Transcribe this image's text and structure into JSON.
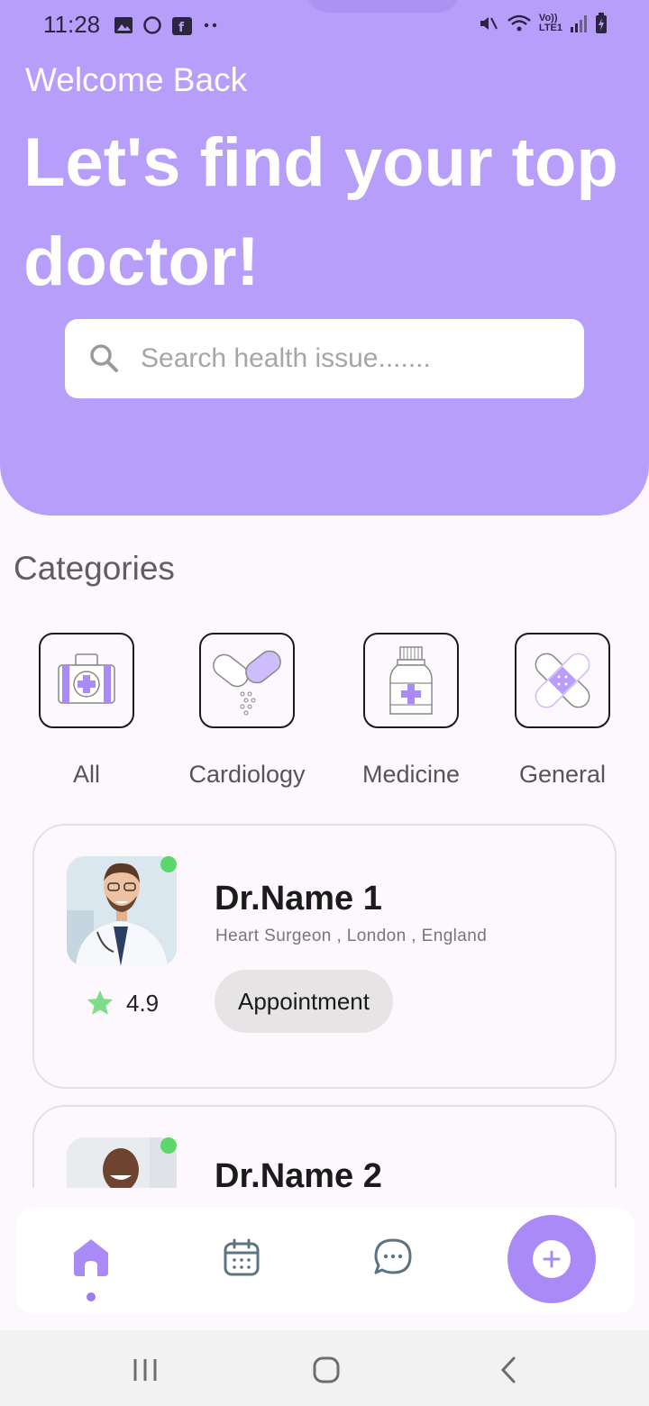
{
  "status_bar": {
    "time": "11:28",
    "network_label_top": "Vo))",
    "network_label_bottom": "LTE1"
  },
  "header": {
    "welcome": "Welcome Back",
    "headline": "Let's find your top doctor!"
  },
  "search": {
    "placeholder": "Search health issue.......",
    "icon": "search-icon"
  },
  "categories": {
    "title": "Categories",
    "items": [
      {
        "label": "All",
        "icon": "first-aid-kit-icon"
      },
      {
        "label": "Cardiology",
        "icon": "capsule-icon"
      },
      {
        "label": "Medicine",
        "icon": "medicine-bottle-icon"
      },
      {
        "label": "General",
        "icon": "bandage-icon"
      }
    ]
  },
  "doctors": [
    {
      "name": "Dr.Name 1",
      "info": "Heart Surgeon , London , England",
      "rating": "4.9",
      "action": "Appointment",
      "online": true
    },
    {
      "name": "Dr.Name 2",
      "online": true
    }
  ],
  "bottom_nav": {
    "items": [
      "home-icon",
      "calendar-icon",
      "chat-icon"
    ],
    "active": "home",
    "fab_icon": "plus-icon"
  },
  "colors": {
    "primary": "#b89efb",
    "accent": "#a98af6",
    "online": "#5bd76b",
    "star": "#7fdc8a",
    "background": "#fdf8fd"
  }
}
